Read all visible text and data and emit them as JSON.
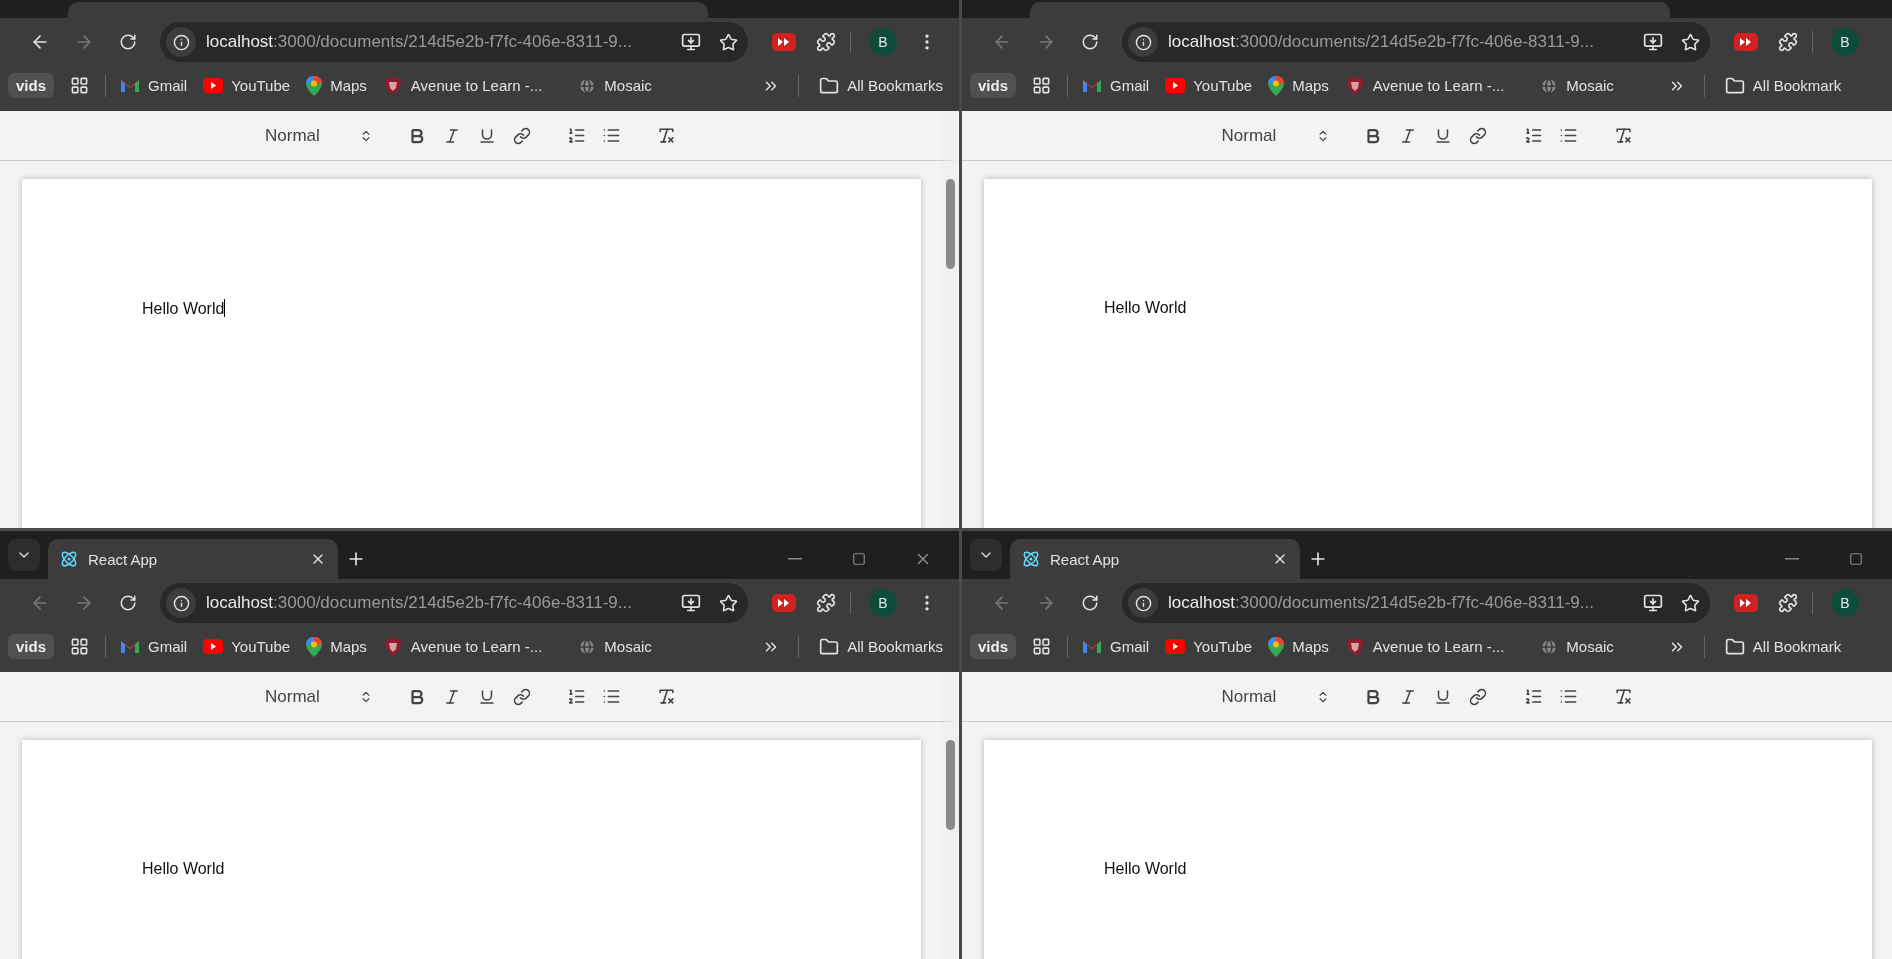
{
  "windows": [
    {
      "back_enabled": true,
      "url_host": "localhost",
      "url_rest": ":3000/documents/214d5e2b-f7fc-406e-8311-9...",
      "profile": "B",
      "show_menu": true,
      "chip": "vids",
      "bookmarks": [
        {
          "kind": "gmail",
          "label": "Gmail"
        },
        {
          "kind": "youtube",
          "label": "YouTube"
        },
        {
          "kind": "maps",
          "label": "Maps"
        },
        {
          "kind": "crest",
          "label": "Avenue to Learn -..."
        },
        {
          "kind": "globe",
          "label": "Mosaic"
        }
      ],
      "all_bookmarks": "All Bookmarks",
      "format": "Normal",
      "document_text": "Hello World",
      "caret": true,
      "scrollbar": true
    },
    {
      "back_enabled": false,
      "url_host": "localhost",
      "url_rest": ":3000/documents/214d5e2b-f7fc-406e-8311-9...",
      "profile": "B",
      "show_menu": false,
      "chip": "vids",
      "bookmarks": [
        {
          "kind": "gmail",
          "label": "Gmail"
        },
        {
          "kind": "youtube",
          "label": "YouTube"
        },
        {
          "kind": "maps",
          "label": "Maps"
        },
        {
          "kind": "crest",
          "label": "Avenue to Learn -..."
        },
        {
          "kind": "globe",
          "label": "Mosaic"
        }
      ],
      "all_bookmarks": "All Bookmark",
      "format": "Normal",
      "document_text": "Hello World",
      "caret": false,
      "scrollbar": false
    },
    {
      "tab": {
        "title": "React App"
      },
      "back_enabled": false,
      "url_host": "localhost",
      "url_rest": ":3000/documents/214d5e2b-f7fc-406e-8311-9...",
      "profile": "B",
      "show_menu": true,
      "chip": "vids",
      "bookmarks": [
        {
          "kind": "gmail",
          "label": "Gmail"
        },
        {
          "kind": "youtube",
          "label": "YouTube"
        },
        {
          "kind": "maps",
          "label": "Maps"
        },
        {
          "kind": "crest",
          "label": "Avenue to Learn -..."
        },
        {
          "kind": "globe",
          "label": "Mosaic"
        }
      ],
      "all_bookmarks": "All Bookmarks",
      "format": "Normal",
      "document_text": "Hello World",
      "caret": false,
      "scrollbar": true
    },
    {
      "tab": {
        "title": "React App"
      },
      "back_enabled": false,
      "url_host": "localhost",
      "url_rest": ":3000/documents/214d5e2b-f7fc-406e-8311-9...",
      "profile": "B",
      "show_menu": false,
      "chip": "vids",
      "bookmarks": [
        {
          "kind": "gmail",
          "label": "Gmail"
        },
        {
          "kind": "youtube",
          "label": "YouTube"
        },
        {
          "kind": "maps",
          "label": "Maps"
        },
        {
          "kind": "crest",
          "label": "Avenue to Learn -..."
        },
        {
          "kind": "globe",
          "label": "Mosaic"
        }
      ],
      "all_bookmarks": "All Bookmark",
      "format": "Normal",
      "document_text": "Hello World",
      "caret": false,
      "scrollbar": false
    }
  ]
}
